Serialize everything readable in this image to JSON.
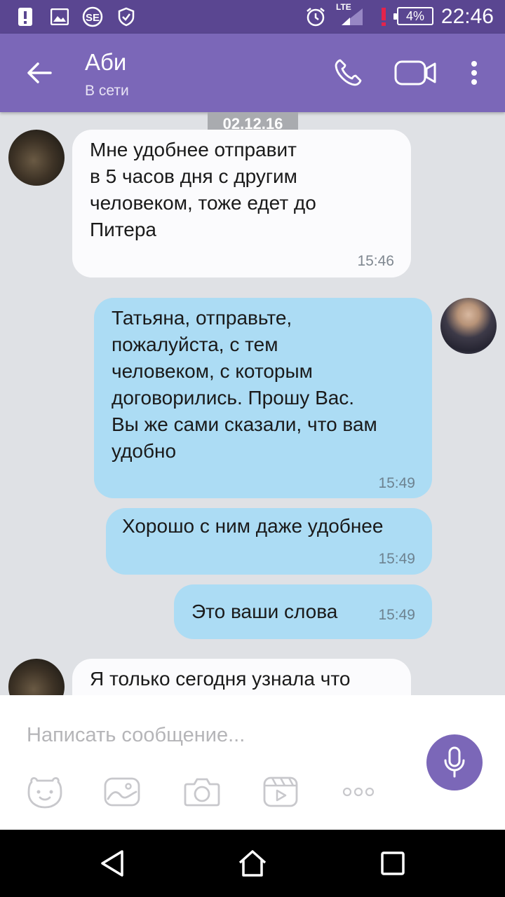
{
  "status_bar": {
    "time": "22:46",
    "battery": "4%",
    "network": "LTE",
    "icons": [
      "notification-alert-icon",
      "gallery-icon",
      "se-app-icon",
      "shield-icon",
      "alarm-icon",
      "signal-icon",
      "battery-icon"
    ]
  },
  "header": {
    "name": "Аби",
    "status": "В сети"
  },
  "chat": {
    "date": "02.12.16",
    "messages": [
      {
        "dir": "in",
        "lines": [
          "Мне удобнее отправит",
          "в 5 часов дня с другим",
          "человеком,  тоже едет до",
          "Питера"
        ],
        "time": "15:46"
      },
      {
        "dir": "out",
        "lines": [
          "Татьяна, отправьте,",
          "пожалуйста, с тем",
          "человеком, с которым",
          "договорились. Прошу Вас.",
          "Вы же сами сказали, что вам",
          "удобно"
        ],
        "time": "15:49"
      },
      {
        "dir": "out",
        "lines": [
          "Хорошо с ним даже удобнее"
        ],
        "time": "15:49"
      },
      {
        "dir": "out",
        "lines": [
          "Это ваши слова"
        ],
        "time": "15:49"
      },
      {
        "dir": "in",
        "lines": [
          "Я только сегодня узнала что"
        ],
        "time": ""
      }
    ]
  },
  "composer": {
    "placeholder": "Написать сообщение...",
    "tools": [
      "sticker-icon",
      "gallery-icon",
      "camera-icon",
      "video-clip-icon",
      "more-options-icon"
    ]
  },
  "colors": {
    "status_bar": "#5a4691",
    "header": "#7b67b8",
    "incoming_bubble": "#fbfbfd",
    "outgoing_bubble": "#acdcf4",
    "chat_background": "#dfe1e5"
  }
}
